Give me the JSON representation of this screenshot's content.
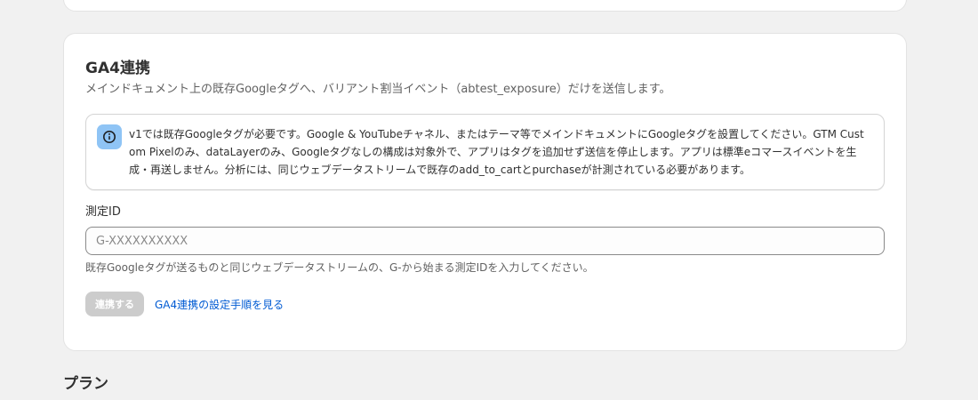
{
  "ga4_section": {
    "title": "GA4連携",
    "description": "メインドキュメント上の既存Googleタグへ、バリアント割当イベント（abtest_exposure）だけを送信します。",
    "notice": {
      "icon": "info-icon",
      "text": "v1では既存Googleタグが必要です。Google & YouTubeチャネル、またはテーマ等でメインドキュメントにGoogleタグを設置してください。GTM Custom Pixelのみ、dataLayerのみ、Googleタグなしの構成は対象外で、アプリはタグを追加せず送信を停止します。アプリは標準eコマースイベントを生成・再送しません。分析には、同じウェブデータストリームで既存のadd_to_cartとpurchaseが計測されている必要があります。"
    },
    "measurement_id": {
      "label": "測定ID",
      "value": "",
      "placeholder": "G-XXXXXXXXXX",
      "help": "既存Googleタグが送るものと同じウェブデータストリームの、G-から始まる測定IDを入力してください。"
    },
    "connect_button": "連携する",
    "guide_link": "GA4連携の設定手順を見る"
  },
  "plan_section": {
    "title": "プラン"
  },
  "colors": {
    "page_background": "#f1f1f1",
    "card_background": "#ffffff",
    "info_icon_background": "#8fc4f5",
    "disabled_button": "#cccccc",
    "link": "#005bd3"
  }
}
